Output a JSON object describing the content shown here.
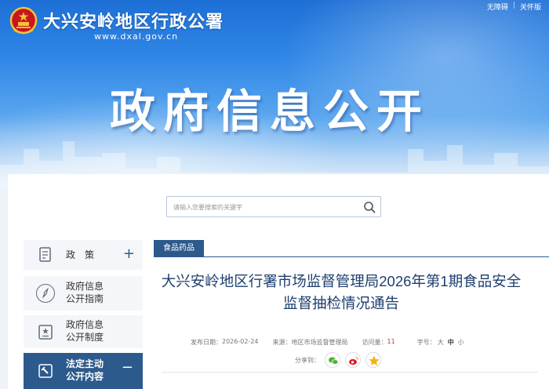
{
  "header": {
    "site_name": "大兴安岭地区行政公署",
    "domain": "www.dxal.gov.cn",
    "accessibility_link": "无障碍",
    "elderly_link": "关怀版",
    "hero_title": "政府信息公开"
  },
  "search": {
    "placeholder": "请输入您要搜索的关键字"
  },
  "sidebar": {
    "items": [
      {
        "label": "政　策",
        "toggle": "+"
      },
      {
        "label_line1": "政府信息",
        "label_line2": "公开指南"
      },
      {
        "label_line1": "政府信息",
        "label_line2": "公开制度"
      },
      {
        "label_line1": "法定主动",
        "label_line2": "公开内容",
        "toggle": "−"
      }
    ]
  },
  "article": {
    "category": "食品药品",
    "title": "大兴安岭地区行署市场监督管理局2026年第1期食品安全监督抽检情况通告",
    "publish_label": "发布日期：",
    "publish_date": "2026-02-24",
    "source_label": "来源：",
    "source": "地区市场监督管理局",
    "views_label": "访问量：",
    "views": "11",
    "font_label": "字号：",
    "font_large": "大",
    "font_medium": "中",
    "font_small": "小",
    "share_label": "分享到："
  },
  "colors": {
    "primary": "#2d5a8c",
    "title": "#1e3f6e",
    "banner_top": "#1d6fd6",
    "wechat": "#51b332",
    "weibo": "#e6162d",
    "qzone": "#f5b300"
  }
}
